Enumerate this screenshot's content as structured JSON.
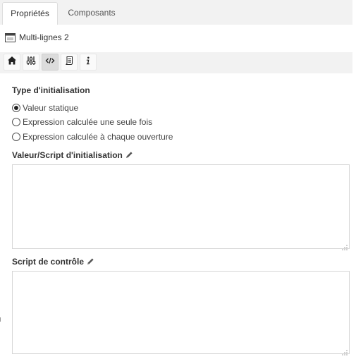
{
  "tabs": [
    {
      "label": "Propriétés",
      "active": true
    },
    {
      "label": "Composants",
      "active": false
    }
  ],
  "component": {
    "icon": "window-icon",
    "name": "Multi-lignes 2"
  },
  "toolbar": {
    "buttons": [
      {
        "icon": "home-icon"
      },
      {
        "icon": "sliders-icon"
      },
      {
        "icon": "code-icon",
        "active": true
      },
      {
        "icon": "script-icon"
      },
      {
        "icon": "info-icon"
      }
    ]
  },
  "init": {
    "section_label": "Type d'initialisation",
    "options": [
      {
        "label": "Valeur statique",
        "selected": true
      },
      {
        "label": "Expression calculée une seule fois",
        "selected": false
      },
      {
        "label": "Expression calculée à chaque ouverture",
        "selected": false
      }
    ]
  },
  "value_script": {
    "label": "Valeur/Script d'initialisation",
    "value": ""
  },
  "control_script": {
    "label": "Script de contrôle",
    "value": ""
  },
  "colors": {
    "tab_bar": "#f2f2f2",
    "border": "#d6d6d6",
    "text": "#333333"
  }
}
